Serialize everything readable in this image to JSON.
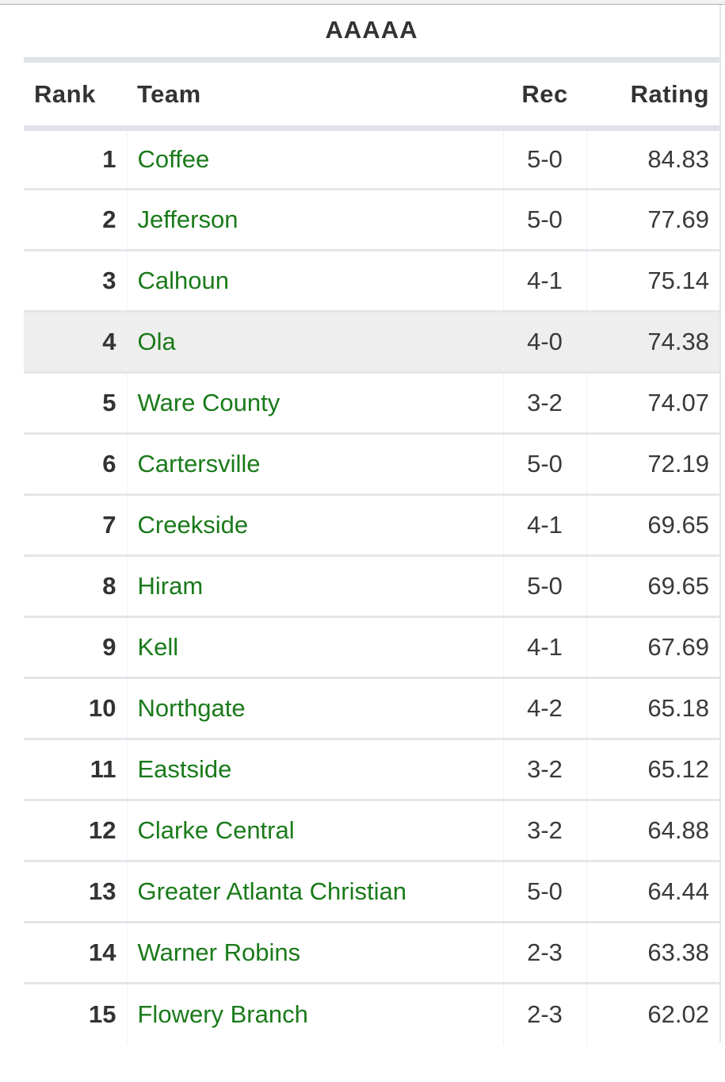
{
  "caption": "AAAAA",
  "columns": {
    "rank": "Rank",
    "team": "Team",
    "rec": "Rec",
    "rating": "Rating"
  },
  "colors": {
    "team_link": "#1a7a1a",
    "text": "#333333",
    "highlight_row": "#eeeeee",
    "border": "#dfe2e6"
  },
  "highlighted_rank": 4,
  "rows": [
    {
      "rank": "1",
      "team": "Coffee",
      "rec": "5-0",
      "rating": "84.83"
    },
    {
      "rank": "2",
      "team": "Jefferson",
      "rec": "5-0",
      "rating": "77.69"
    },
    {
      "rank": "3",
      "team": "Calhoun",
      "rec": "4-1",
      "rating": "75.14"
    },
    {
      "rank": "4",
      "team": "Ola",
      "rec": "4-0",
      "rating": "74.38"
    },
    {
      "rank": "5",
      "team": "Ware County",
      "rec": "3-2",
      "rating": "74.07"
    },
    {
      "rank": "6",
      "team": "Cartersville",
      "rec": "5-0",
      "rating": "72.19"
    },
    {
      "rank": "7",
      "team": "Creekside",
      "rec": "4-1",
      "rating": "69.65"
    },
    {
      "rank": "8",
      "team": "Hiram",
      "rec": "5-0",
      "rating": "69.65"
    },
    {
      "rank": "9",
      "team": "Kell",
      "rec": "4-1",
      "rating": "67.69"
    },
    {
      "rank": "10",
      "team": "Northgate",
      "rec": "4-2",
      "rating": "65.18"
    },
    {
      "rank": "11",
      "team": "Eastside",
      "rec": "3-2",
      "rating": "65.12"
    },
    {
      "rank": "12",
      "team": "Clarke Central",
      "rec": "3-2",
      "rating": "64.88"
    },
    {
      "rank": "13",
      "team": "Greater Atlanta Christian",
      "rec": "5-0",
      "rating": "64.44"
    },
    {
      "rank": "14",
      "team": "Warner Robins",
      "rec": "2-3",
      "rating": "63.38"
    },
    {
      "rank": "15",
      "team": "Flowery Branch",
      "rec": "2-3",
      "rating": "62.02"
    }
  ]
}
